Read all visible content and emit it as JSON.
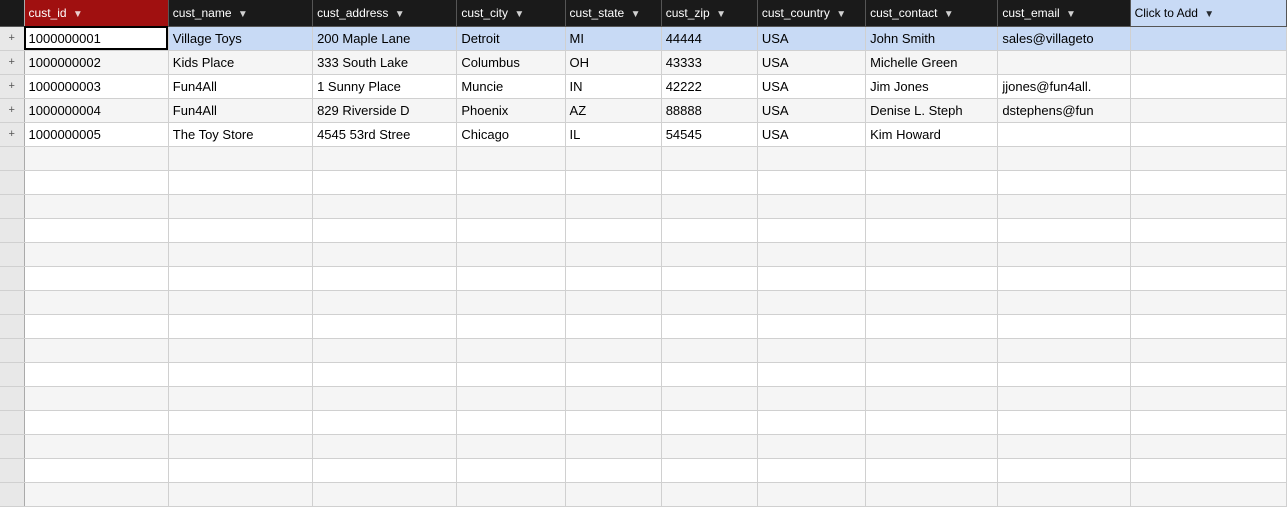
{
  "colors": {
    "header_bg": "#1a1a1a",
    "header_cust_id_bg": "#a01010",
    "selected_row_bg": "#c8daf5",
    "click_to_add_bg": "#c8daf5"
  },
  "columns": [
    {
      "id": "expander",
      "label": "",
      "class": "expander-cell col-expander"
    },
    {
      "id": "cust_id",
      "label": "cust_id",
      "class": "col-cust-id col-cust-id",
      "sortable": true
    },
    {
      "id": "cust_name",
      "label": "cust_name",
      "class": "col-cust-name",
      "sortable": true
    },
    {
      "id": "cust_address",
      "label": "cust_address",
      "class": "col-cust-addr",
      "sortable": true
    },
    {
      "id": "cust_city",
      "label": "cust_city",
      "class": "col-cust-city",
      "sortable": true
    },
    {
      "id": "cust_state",
      "label": "cust_state",
      "class": "col-cust-state",
      "sortable": true
    },
    {
      "id": "cust_zip",
      "label": "cust_zip",
      "class": "col-cust-zip",
      "sortable": true
    },
    {
      "id": "cust_country",
      "label": "cust_country",
      "class": "col-cust-country",
      "sortable": true
    },
    {
      "id": "cust_contact",
      "label": "cust_contact",
      "class": "col-cust-contact",
      "sortable": true
    },
    {
      "id": "cust_email",
      "label": "cust_email",
      "class": "col-cust-email",
      "sortable": true
    },
    {
      "id": "click_to_add",
      "label": "Click to Add",
      "class": "col-click-add click-to-add",
      "sortable": true
    }
  ],
  "rows": [
    {
      "selected": true,
      "editing": true,
      "cust_id": "1000000001",
      "cust_name": "Village Toys",
      "cust_address": "200 Maple Lane",
      "cust_city": "Detroit",
      "cust_state": "MI",
      "cust_zip": "44444",
      "cust_country": "USA",
      "cust_contact": "John Smith",
      "cust_email": "sales@villageto"
    },
    {
      "cust_id": "1000000002",
      "cust_name": "Kids Place",
      "cust_address": "333 South Lake",
      "cust_city": "Columbus",
      "cust_state": "OH",
      "cust_zip": "43333",
      "cust_country": "USA",
      "cust_contact": "Michelle Green",
      "cust_email": ""
    },
    {
      "cust_id": "1000000003",
      "cust_name": "Fun4All",
      "cust_address": "1 Sunny Place",
      "cust_city": "Muncie",
      "cust_state": "IN",
      "cust_zip": "42222",
      "cust_country": "USA",
      "cust_contact": "Jim Jones",
      "cust_email": "jjones@fun4all."
    },
    {
      "cust_id": "1000000004",
      "cust_name": "Fun4All",
      "cust_address": "829 Riverside D",
      "cust_city": "Phoenix",
      "cust_state": "AZ",
      "cust_zip": "88888",
      "cust_country": "USA",
      "cust_contact": "Denise L. Steph",
      "cust_email": "dstephens@fun"
    },
    {
      "cust_id": "1000000005",
      "cust_name": "The Toy Store",
      "cust_address": "4545 53rd Stree",
      "cust_city": "Chicago",
      "cust_state": "IL",
      "cust_zip": "54545",
      "cust_country": "USA",
      "cust_contact": "Kim Howard",
      "cust_email": ""
    }
  ],
  "labels": {
    "click_to_add": "Click to Add",
    "sort_asc": "▲",
    "sort_desc": "▼",
    "filter": "▼",
    "expander": "+"
  }
}
